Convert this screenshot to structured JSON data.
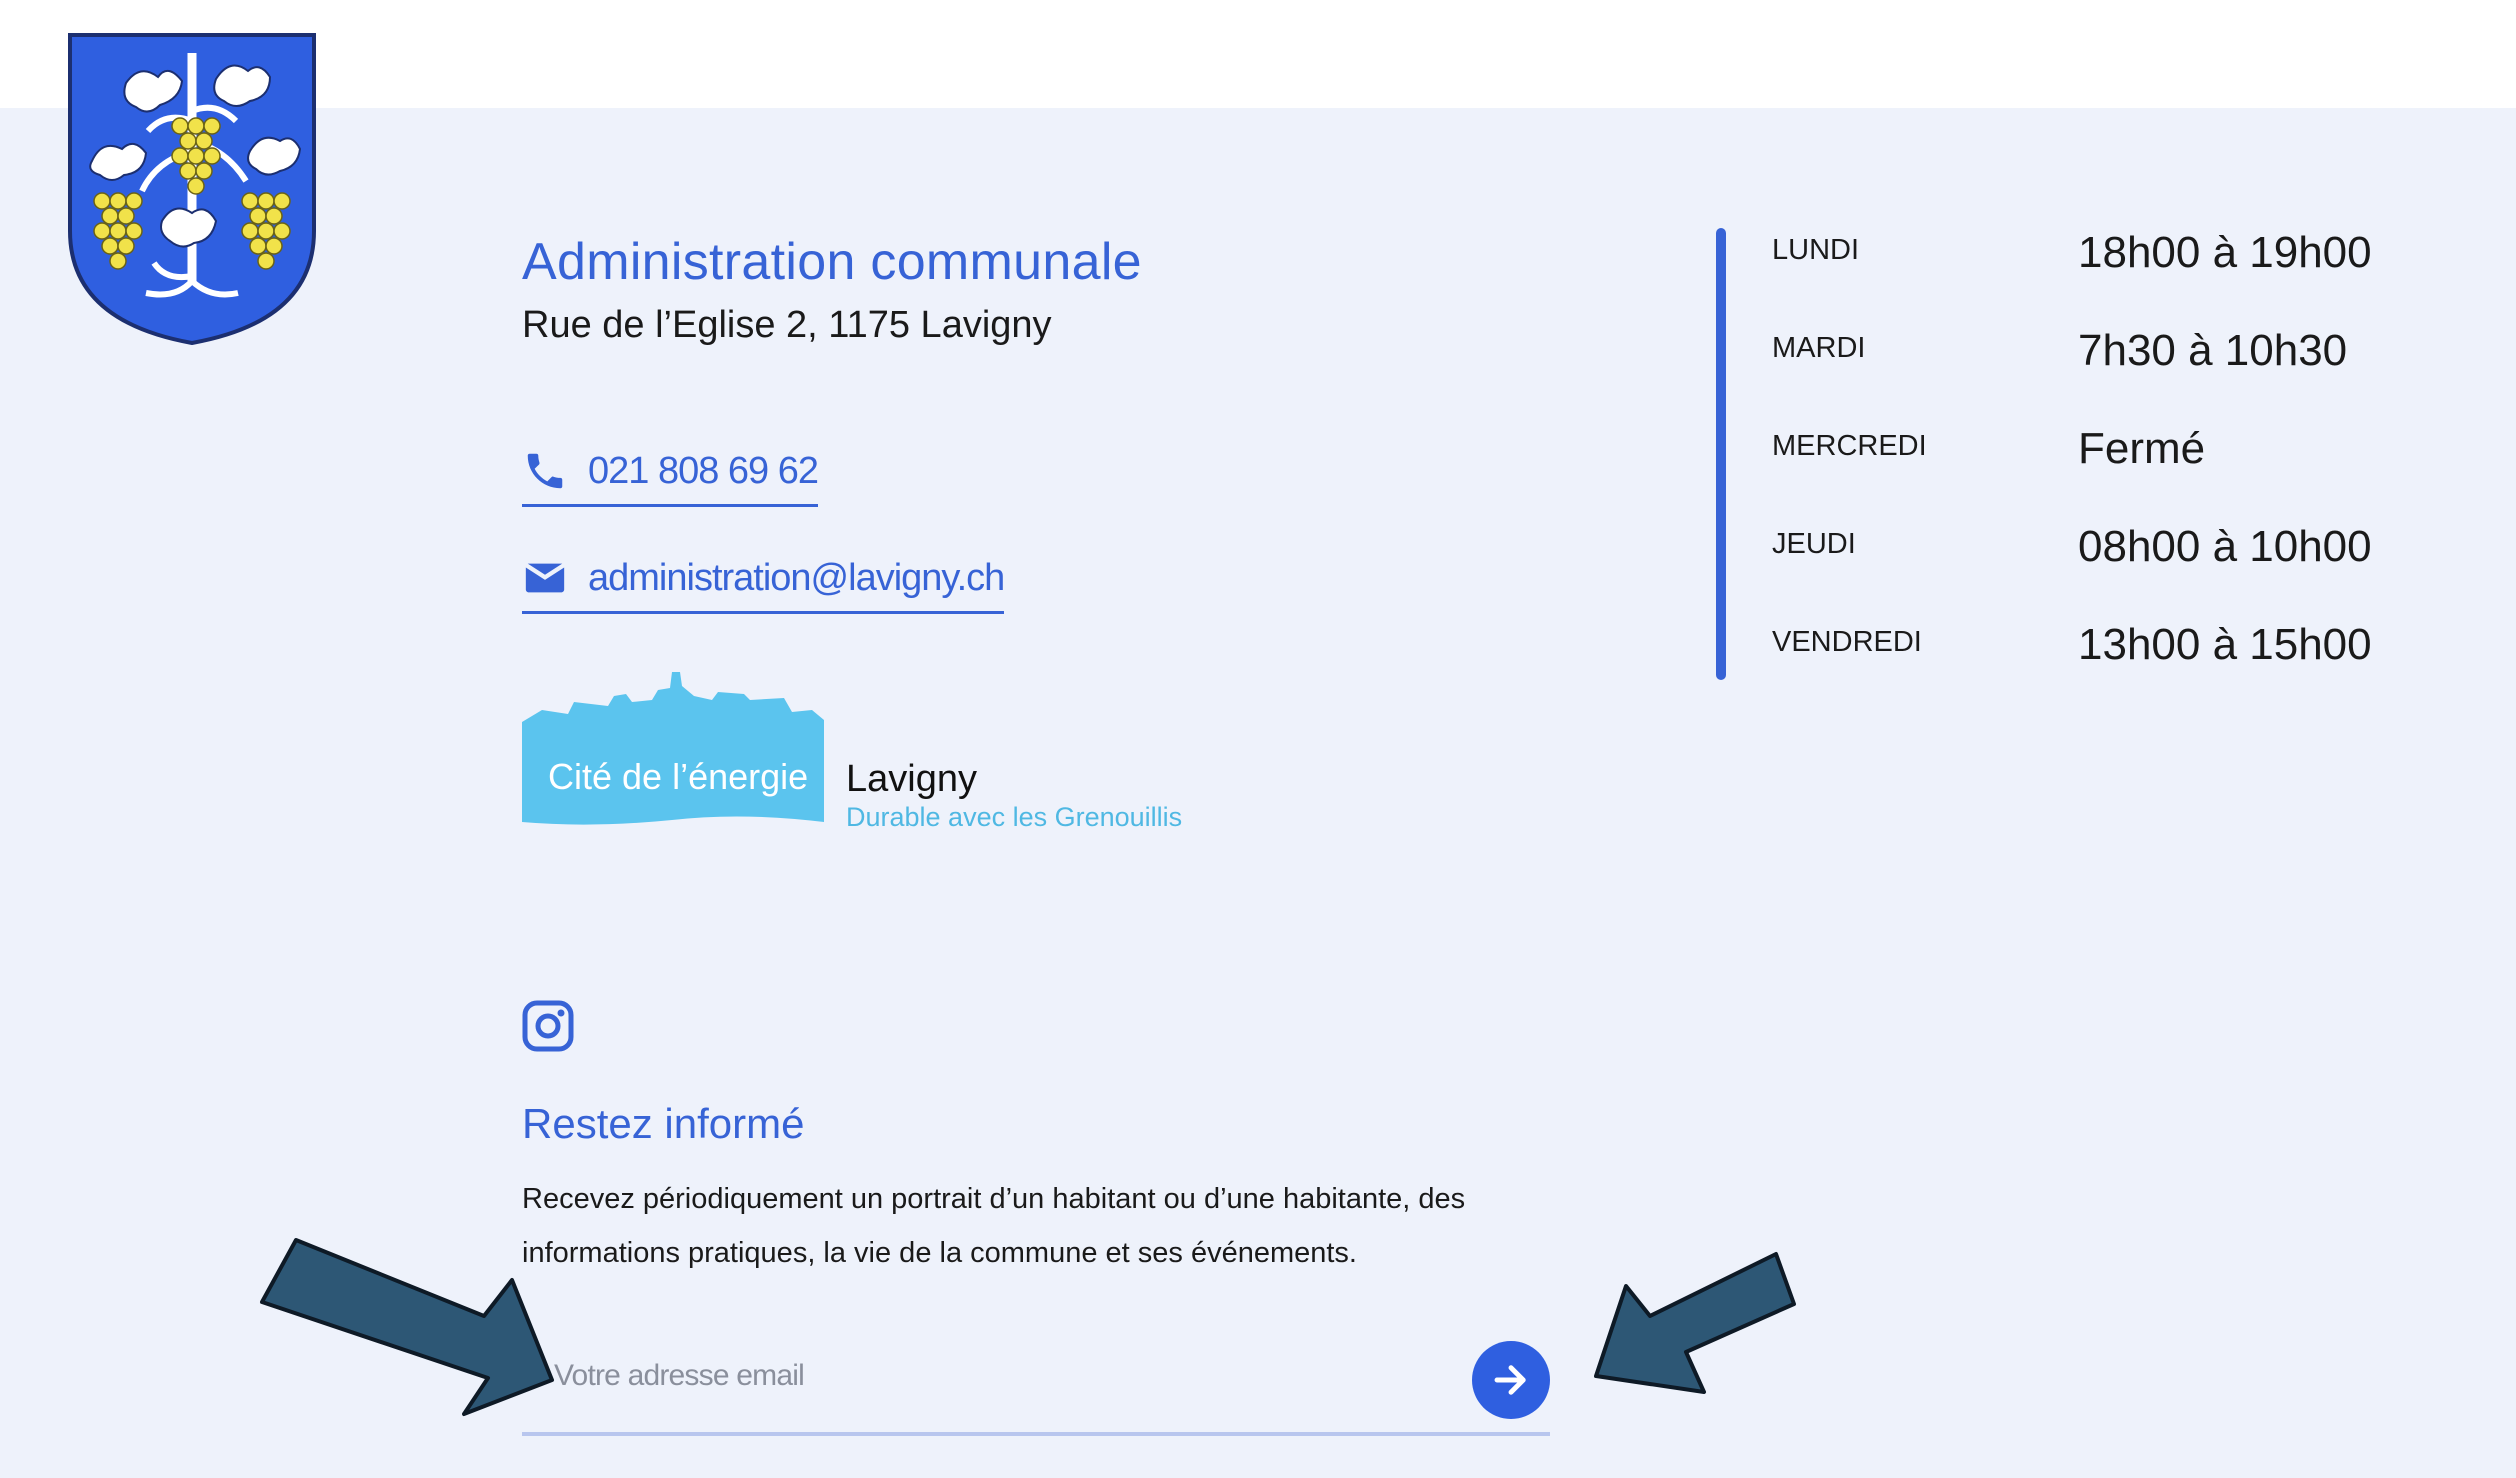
{
  "header": {
    "crest_alt": "Lavigny coat of arms"
  },
  "contact": {
    "title": "Administration communale",
    "address": "Rue de l’Eglise 2, 1175 Lavigny",
    "phone": "021 808 69 62",
    "email": "administration@lavigny.ch"
  },
  "energy": {
    "badge": "Cité de l’énergie",
    "place": "Lavigny",
    "tagline": "Durable avec les Grenouillis"
  },
  "social": {
    "icons": [
      "instagram-icon"
    ]
  },
  "newsletter": {
    "title": "Restez informé",
    "description": "Recevez périodiquement un portrait d’un habitant ou d’une habitante, des informations pratiques, la vie de la commune et ses événements.",
    "email_placeholder": "Votre adresse email",
    "submit_icon": "arrow-right-icon"
  },
  "hours": [
    {
      "day": "LUNDI",
      "time": "18h00 à 19h00"
    },
    {
      "day": "MARDI",
      "time": "7h30 à 10h30"
    },
    {
      "day": "MERCREDI",
      "time": "Fermé"
    },
    {
      "day": "JEUDI",
      "time": "08h00 à 10h00"
    },
    {
      "day": "VENDREDI",
      "time": "13h00 à 15h00"
    }
  ],
  "colors": {
    "accent": "#3763d6",
    "button": "#2f5fe0",
    "page_background": "#eef2fb",
    "annotation_arrow": "#2d5775",
    "energy_blue": "#5bc4ee"
  }
}
